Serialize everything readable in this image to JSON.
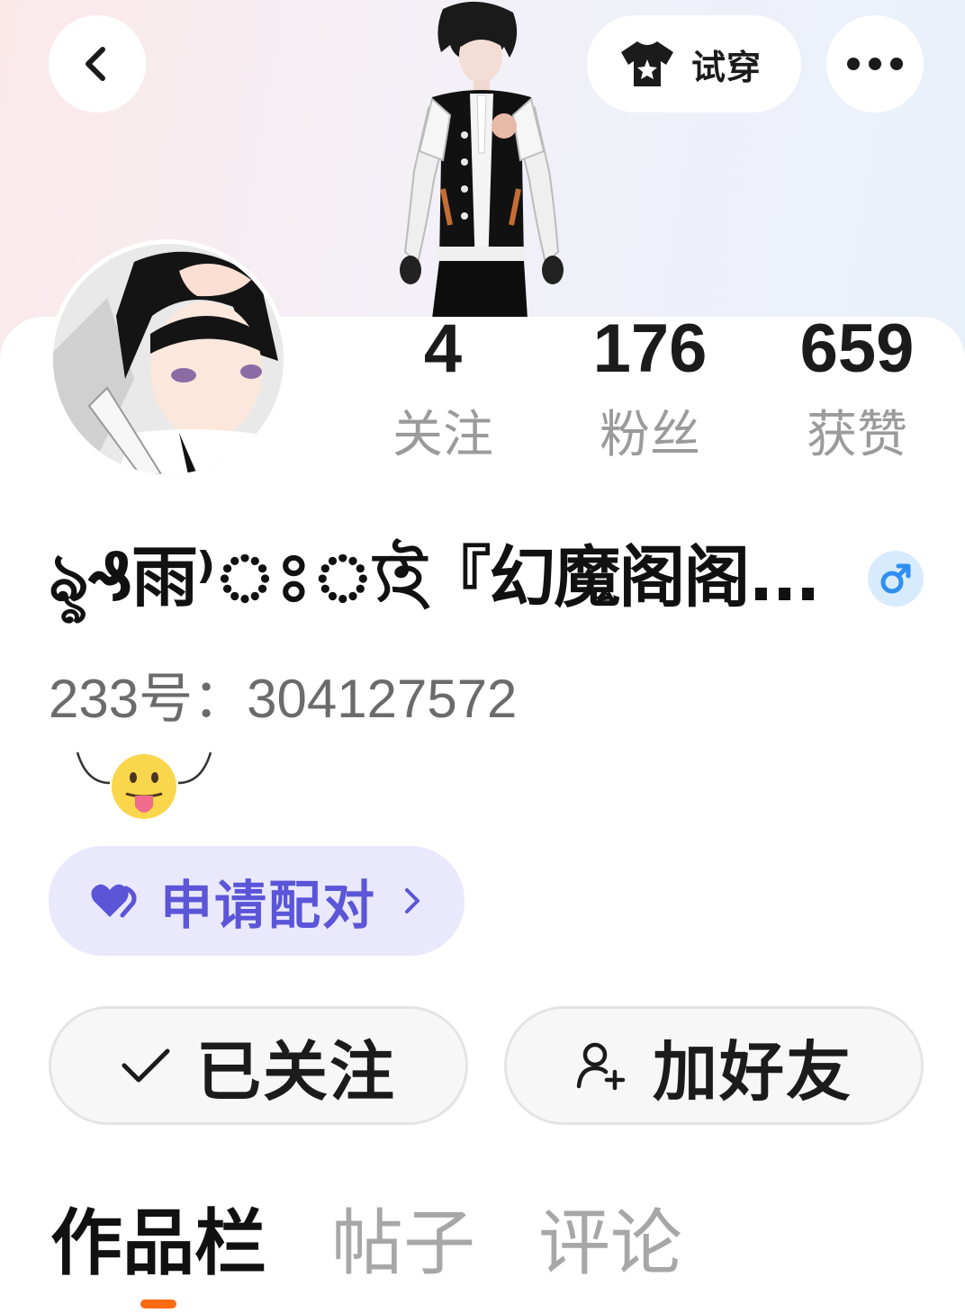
{
  "header": {
    "try_on_label": "试穿"
  },
  "stats": [
    {
      "value": "4",
      "label": "关注"
    },
    {
      "value": "176",
      "label": "粉丝"
    },
    {
      "value": "659",
      "label": "获赞"
    }
  ],
  "profile": {
    "name": "ৡ₰雨⁾ঃ্যই『幻魔阁阁...",
    "uid": "233号：304127572",
    "gender": "male"
  },
  "pair_button": {
    "label": "申请配对"
  },
  "actions": {
    "followed_label": "已关注",
    "add_friend_label": "加好友"
  },
  "tabs": [
    {
      "label": "作品栏",
      "active": true
    },
    {
      "label": "帖子",
      "active": false
    },
    {
      "label": "评论",
      "active": false
    }
  ],
  "colors": {
    "accent_purple": "#5b55d8",
    "gender_blue": "#2f8ff0",
    "tab_indicator": "#ff6a13"
  }
}
